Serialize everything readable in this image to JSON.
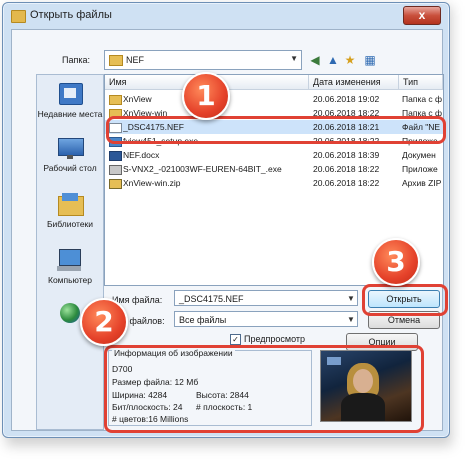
{
  "window": {
    "title": "Открыть файлы",
    "close_glyph": "x"
  },
  "toolbar": {
    "look_in_label": "Папка:",
    "look_in_value": "NEF",
    "back_glyph": "◀",
    "up_glyph": "▲",
    "new_folder_glyph": "★",
    "view_glyph": "▦"
  },
  "places": [
    {
      "label": "Недавние места",
      "icon": "recent-places-icon"
    },
    {
      "label": "Рабочий стол",
      "icon": "desktop-icon"
    },
    {
      "label": "Библиотеки",
      "icon": "libraries-icon"
    },
    {
      "label": "Компьютер",
      "icon": "computer-icon"
    },
    {
      "label": "",
      "icon": "network-icon"
    }
  ],
  "columns": {
    "name": "Имя",
    "date": "Дата изменения",
    "type": "Тип"
  },
  "files": [
    {
      "name": "XnView",
      "date": "20.06.2018 19:02",
      "type": "Папка с ф",
      "icon": "folder-icon"
    },
    {
      "name": "XnView-win",
      "date": "20.06.2018 18:22",
      "type": "Папка с ф",
      "icon": "folder-icon"
    },
    {
      "name": "_DSC4175.NEF",
      "date": "20.06.2018 18:21",
      "type": "Файл \"NE",
      "icon": "nef-file-icon",
      "selected": true
    },
    {
      "name": "fview451_setup.exe",
      "date": "20.06.2018 18:22",
      "type": "Приложе",
      "icon": "exe-icon"
    },
    {
      "name": "NEF.docx",
      "date": "20.06.2018 18:39",
      "type": "Докумен",
      "icon": "docx-icon"
    },
    {
      "name": "S-VNX2_-021003WF-EUREN-64BIT_.exe",
      "date": "20.06.2018 18:22",
      "type": "Приложе",
      "icon": "exe-icon"
    },
    {
      "name": "XnView-win.zip",
      "date": "20.06.2018 18:22",
      "type": "Архив ZIP",
      "icon": "zip-icon"
    }
  ],
  "filename": {
    "label": "Имя файла:",
    "value": "_DSC4175.NEF"
  },
  "filetype": {
    "label": "Тип файлов:",
    "value": "Все файлы"
  },
  "buttons": {
    "open": "Открыть",
    "cancel": "Отмена",
    "other": "Опции"
  },
  "preview": {
    "label": "Предпросмотр",
    "check": "✓"
  },
  "info": {
    "legend": "Информация об изображении",
    "camera": "D700",
    "size": "Размер файла: 12 Мб",
    "width": "Ширина: 4284",
    "height": "Высота: 2844",
    "bits": "Бит/плоскость: 24",
    "planes": "# плоскость: 1",
    "colors": "# цветов:16 Millions"
  },
  "badges": [
    "1",
    "2",
    "3"
  ],
  "colors": {
    "callout": "#e04134",
    "selection": "#cde3fa",
    "window": "#cfe1f3"
  }
}
